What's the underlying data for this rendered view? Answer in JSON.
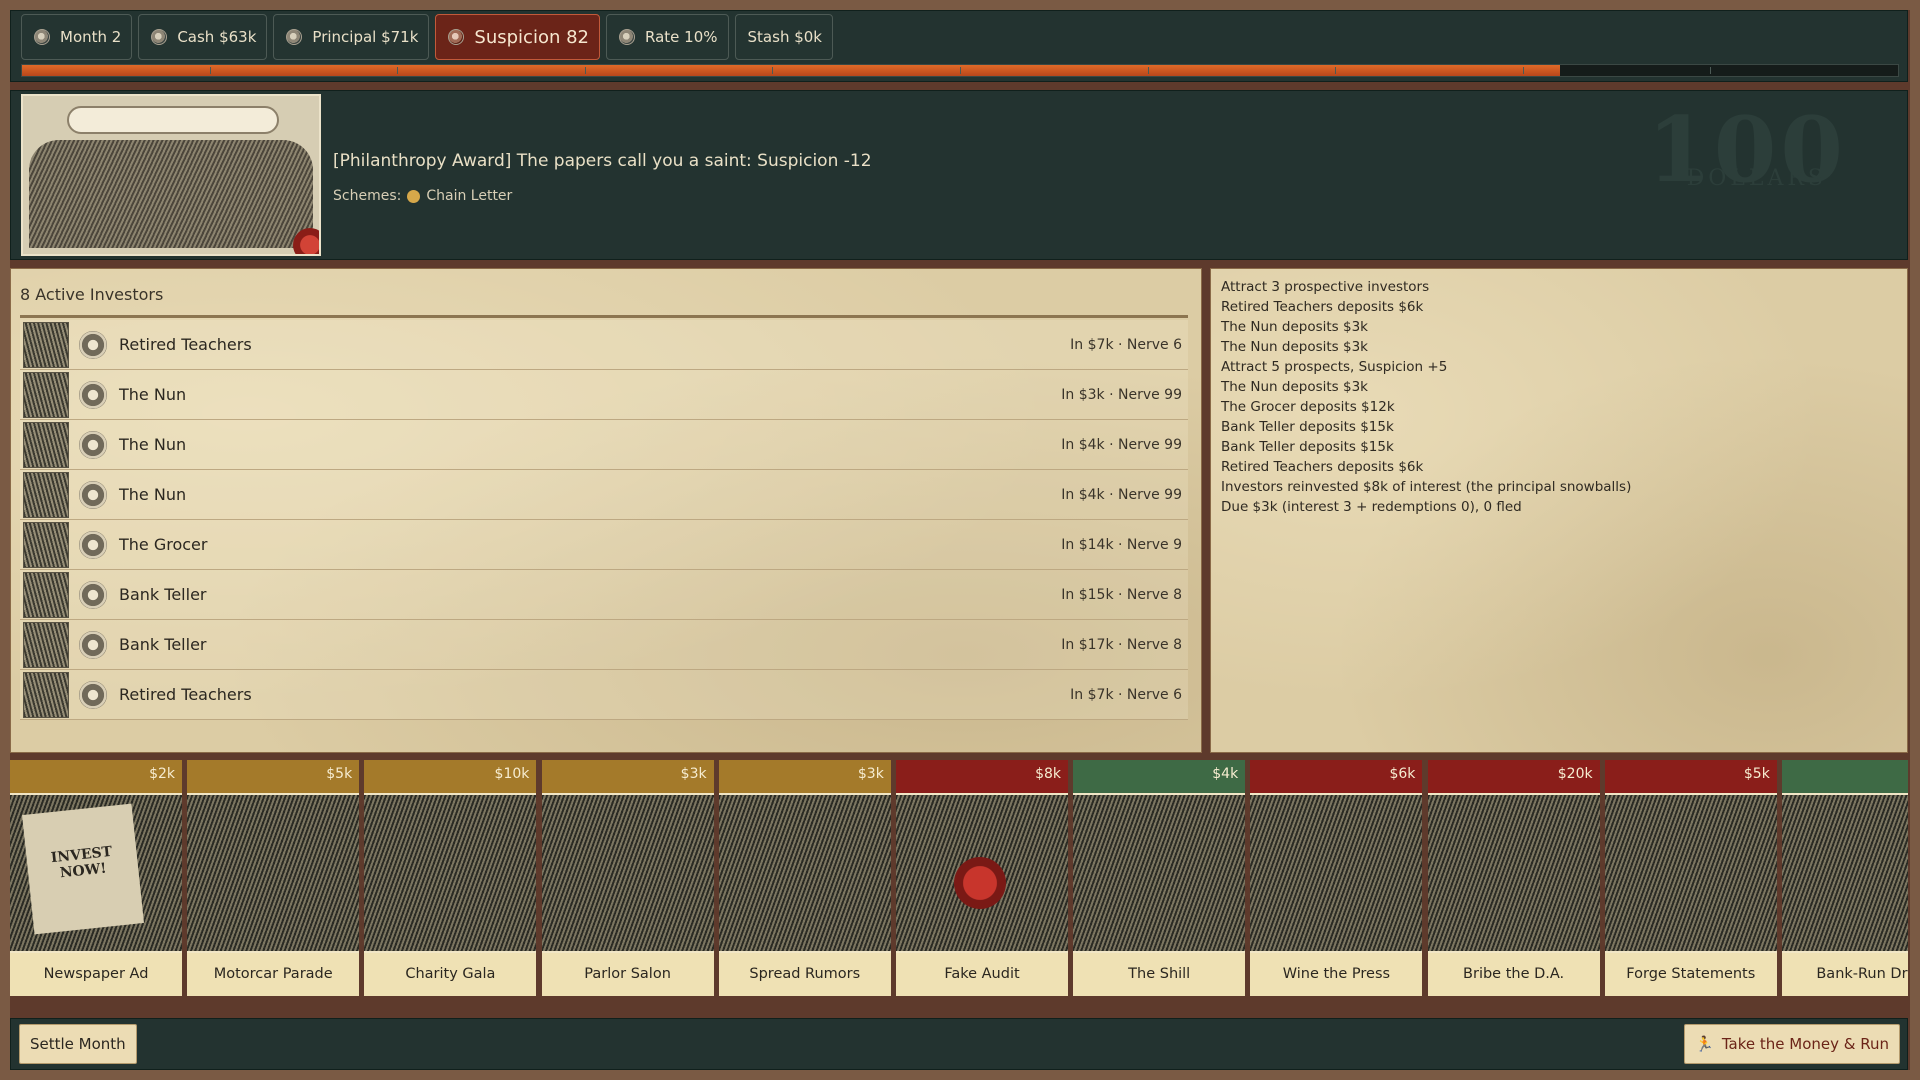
{
  "stats": [
    {
      "key": "month",
      "label": "Month 2",
      "icon": "clock-icon",
      "hot": false
    },
    {
      "key": "cash",
      "label": "Cash $63k",
      "icon": "coin-icon",
      "hot": false
    },
    {
      "key": "principal",
      "label": "Principal $71k",
      "icon": "coin-icon",
      "hot": false
    },
    {
      "key": "suspicion",
      "label": "Suspicion 82",
      "icon": "eye-icon",
      "hot": true
    },
    {
      "key": "rate",
      "label": "Rate 10%",
      "icon": "coin-icon",
      "hot": false
    },
    {
      "key": "stash",
      "label": "Stash $0k",
      "icon": "none",
      "hot": false
    }
  ],
  "suspicion_meter": {
    "value": 82,
    "max": 100,
    "color": "#e06a28"
  },
  "event": {
    "image_icon": "philanthropy-award-engraving",
    "message": "[Philanthropy Award] The papers call you a saint: Suspicion -12",
    "schemes_label": "Schemes:",
    "scheme_name": "Chain Letter",
    "scheme_color": "#d6a84a"
  },
  "investors": {
    "title": "8 Active Investors",
    "rows": [
      {
        "name": "Retired Teachers",
        "stat": "In $7k · Nerve 6"
      },
      {
        "name": "The Nun",
        "stat": "In $3k · Nerve 99"
      },
      {
        "name": "The Nun",
        "stat": "In $4k · Nerve 99"
      },
      {
        "name": "The Nun",
        "stat": "In $4k · Nerve 99"
      },
      {
        "name": "The Grocer",
        "stat": "In $14k · Nerve 9"
      },
      {
        "name": "Bank Teller",
        "stat": "In $15k · Nerve 8"
      },
      {
        "name": "Bank Teller",
        "stat": "In $17k · Nerve 8"
      },
      {
        "name": "Retired Teachers",
        "stat": "In $7k · Nerve 6"
      }
    ]
  },
  "log": [
    "Attract 3 prospective investors",
    "Retired Teachers deposits $6k",
    "The Nun deposits $3k",
    "The Nun deposits $3k",
    "Attract 5 prospects, Suspicion +5",
    "The Nun deposits $3k",
    "The Grocer deposits $12k",
    "Bank Teller deposits $15k",
    "Bank Teller deposits $15k",
    "Retired Teachers deposits $6k",
    "Investors reinvested $8k of interest (the principal snowballs)",
    "Due $3k (interest 3 + redemptions 0), 0 fled"
  ],
  "cards": [
    {
      "name": "Newspaper Ad",
      "cost": "$2k",
      "tier": "gold",
      "paper": "INVEST NOW!"
    },
    {
      "name": "Motorcar Parade",
      "cost": "$5k",
      "tier": "gold"
    },
    {
      "name": "Charity Gala",
      "cost": "$10k",
      "tier": "gold"
    },
    {
      "name": "Parlor Salon",
      "cost": "$3k",
      "tier": "gold"
    },
    {
      "name": "Spread Rumors",
      "cost": "$3k",
      "tier": "gold"
    },
    {
      "name": "Fake Audit",
      "cost": "$8k",
      "tier": "red",
      "wax": true
    },
    {
      "name": "The Shill",
      "cost": "$4k",
      "tier": "green"
    },
    {
      "name": "Wine the Press",
      "cost": "$6k",
      "tier": "red"
    },
    {
      "name": "Bribe the D.A.",
      "cost": "$20k",
      "tier": "red"
    },
    {
      "name": "Forge Statements",
      "cost": "$5k",
      "tier": "red"
    },
    {
      "name": "Bank-Run Drill",
      "cost": "",
      "tier": "green"
    }
  ],
  "actions": {
    "settle": "Settle Month",
    "run": "Take the Money & Run",
    "run_icon": "running-man-icon"
  },
  "banner_watermark": {
    "big": "100",
    "small": "DOLLARS"
  }
}
